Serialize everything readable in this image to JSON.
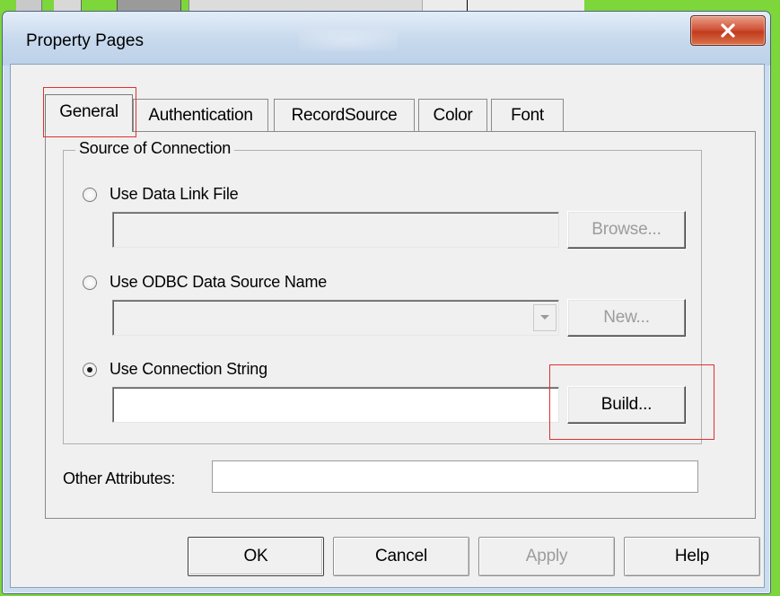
{
  "dialog": {
    "title": "Property Pages",
    "close_icon": "close-x-icon"
  },
  "tabs": [
    {
      "label": "General",
      "active": true
    },
    {
      "label": "Authentication",
      "active": false
    },
    {
      "label": "RecordSource",
      "active": false
    },
    {
      "label": "Color",
      "active": false
    },
    {
      "label": "Font",
      "active": false
    }
  ],
  "source_group": {
    "title": "Source of Connection",
    "data_link": {
      "label": "Use Data Link File",
      "selected": false,
      "value": "",
      "browse_label": "Browse..."
    },
    "odbc": {
      "label": "Use ODBC Data Source Name",
      "selected": false,
      "value": "",
      "new_label": "New..."
    },
    "connection_string": {
      "label": "Use Connection String",
      "selected": true,
      "value": "",
      "build_label": "Build..."
    }
  },
  "other_attributes": {
    "label": "Other Attributes:",
    "value": ""
  },
  "footer": {
    "ok_label": "OK",
    "cancel_label": "Cancel",
    "apply_label": "Apply",
    "help_label": "Help"
  },
  "highlight_color": "#e03030",
  "background_color": "#7dd63a"
}
